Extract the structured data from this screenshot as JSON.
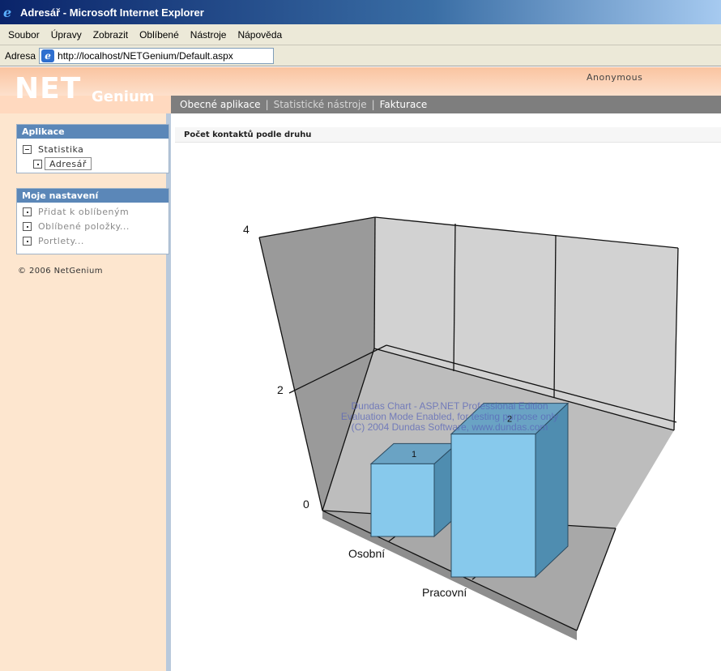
{
  "window": {
    "title": "Adresář - Microsoft Internet Explorer"
  },
  "menu": [
    "Soubor",
    "Úpravy",
    "Zobrazit",
    "Oblíbené",
    "Nástroje",
    "Nápověda"
  ],
  "address": {
    "label": "Adresa",
    "url": "http://localhost/NETGenium/Default.aspx"
  },
  "header": {
    "logo_main": "NET",
    "logo_sub": "Genium",
    "user": "Anonymous"
  },
  "nav": {
    "tabs": [
      "Obecné aplikace",
      "Statistické nástroje",
      "Fakturace"
    ],
    "separator": "|"
  },
  "sidebar": {
    "apps": {
      "title": "Aplikace",
      "items": [
        "Statistika",
        "Adresář"
      ]
    },
    "settings": {
      "title": "Moje nastavení",
      "items": [
        "Přidat k oblíbeným",
        "Oblíbené položky...",
        "Portlety..."
      ]
    },
    "copyright": "© 2006 NetGenium"
  },
  "main": {
    "title": "Počet kontaktů podle druhu"
  },
  "chart_data": {
    "type": "bar",
    "categories": [
      "Osobní",
      "Pracovní"
    ],
    "values": [
      1,
      2
    ],
    "y_ticks": [
      "0",
      "2",
      "4"
    ],
    "ylim": [
      0,
      4
    ],
    "bar_color": "#87c9ec",
    "watermark": [
      "Dundas Chart - ASP.NET Professional Edition",
      "Evaluation Mode Enabled, for testing purpose only",
      "(C) 2004 Dundas Software, www.dundas.com"
    ]
  }
}
